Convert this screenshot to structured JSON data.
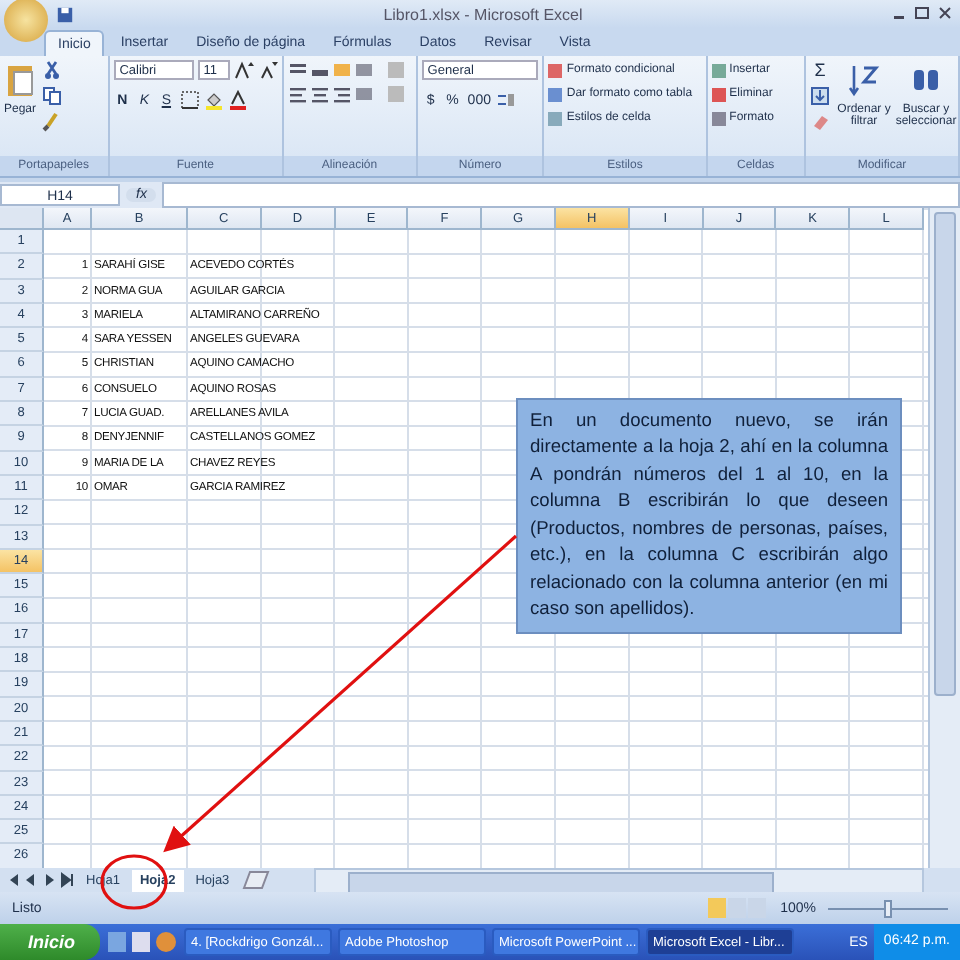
{
  "window": {
    "title": "Libro1.xlsx - Microsoft Excel"
  },
  "tabs": [
    {
      "label": "Inicio",
      "selected": true
    },
    {
      "label": "Insertar",
      "selected": false
    },
    {
      "label": "Diseño de página",
      "selected": false
    },
    {
      "label": "Fórmulas",
      "selected": false
    },
    {
      "label": "Datos",
      "selected": false
    },
    {
      "label": "Revisar",
      "selected": false
    },
    {
      "label": "Vista",
      "selected": false
    }
  ],
  "ribbon": {
    "clipboard": {
      "paste": "Pegar",
      "label": "Portapapeles"
    },
    "font": {
      "name": "Calibri",
      "size": "11",
      "bold": "N",
      "italic": "K",
      "underline": "S",
      "label": "Fuente"
    },
    "alignment": {
      "label": "Alineación"
    },
    "number": {
      "format": "General",
      "currency": "$",
      "percent": "%",
      "thousands": "000",
      "label": "Número"
    },
    "styles": {
      "buttons": [
        "Formato condicional",
        "Dar formato como tabla",
        "Estilos de celda"
      ],
      "label": "Estilos"
    },
    "cells": {
      "buttons": [
        "Insertar",
        "Eliminar",
        "Formato"
      ],
      "label": "Celdas"
    },
    "editing": {
      "sum": "Σ",
      "sort": "Ordenar y filtrar",
      "find": "Buscar y seleccionar",
      "label": "Modificar"
    }
  },
  "formula_bar": {
    "name_box": "H14",
    "fx": "fx"
  },
  "columns": [
    {
      "label": "A",
      "selected": false
    },
    {
      "label": "B",
      "selected": false
    },
    {
      "label": "C",
      "selected": false
    },
    {
      "label": "D",
      "selected": false
    },
    {
      "label": "E",
      "selected": false
    },
    {
      "label": "F",
      "selected": false
    },
    {
      "label": "G",
      "selected": false
    },
    {
      "label": "H",
      "selected": true
    },
    {
      "label": "I",
      "selected": false
    },
    {
      "label": "J",
      "selected": false
    },
    {
      "label": "K",
      "selected": false
    },
    {
      "label": "L",
      "selected": false
    }
  ],
  "rows": [
    {
      "label": "1",
      "selected": false
    },
    {
      "label": "2",
      "selected": false,
      "a": "1",
      "b": "SARAHÍ GISE",
      "c": "ACEVEDO CORTÉS"
    },
    {
      "label": "3",
      "selected": false,
      "a": "2",
      "b": "NORMA GUA",
      "c": "AGUILAR GARCIA"
    },
    {
      "label": "4",
      "selected": false,
      "a": "3",
      "b": "MARIELA",
      "c": "ALTAMIRANO CARREÑO"
    },
    {
      "label": "5",
      "selected": false,
      "a": "4",
      "b": "SARA YESSEN",
      "c": "ANGELES GUEVARA"
    },
    {
      "label": "6",
      "selected": false,
      "a": "5",
      "b": "CHRISTIAN",
      "c": "AQUINO CAMACHO"
    },
    {
      "label": "7",
      "selected": false,
      "a": "6",
      "b": "CONSUELO",
      "c": "AQUINO ROSAS"
    },
    {
      "label": "8",
      "selected": false,
      "a": "7",
      "b": "LUCIA GUAD.",
      "c": "ARELLANES AVILA"
    },
    {
      "label": "9",
      "selected": false,
      "a": "8",
      "b": "DENYJENNIF",
      "c": "CASTELLANOS GOMEZ"
    },
    {
      "label": "10",
      "selected": false,
      "a": "9",
      "b": "MARIA DE LA",
      "c": "CHAVEZ REYES"
    },
    {
      "label": "11",
      "selected": false,
      "a": "10",
      "b": "OMAR",
      "c": "GARCIA RAMIREZ"
    },
    {
      "label": "12",
      "selected": false
    },
    {
      "label": "13",
      "selected": false
    },
    {
      "label": "14",
      "selected": true
    },
    {
      "label": "15",
      "selected": false
    },
    {
      "label": "16",
      "selected": false
    },
    {
      "label": "17",
      "selected": false
    },
    {
      "label": "18",
      "selected": false
    },
    {
      "label": "19",
      "selected": false
    },
    {
      "label": "20",
      "selected": false
    },
    {
      "label": "21",
      "selected": false
    },
    {
      "label": "22",
      "selected": false
    },
    {
      "label": "23",
      "selected": false
    },
    {
      "label": "24",
      "selected": false
    },
    {
      "label": "25",
      "selected": false
    },
    {
      "label": "26",
      "selected": false
    }
  ],
  "sheet_tabs": [
    {
      "label": "Hoja1",
      "selected": false
    },
    {
      "label": "Hoja2",
      "selected": true
    },
    {
      "label": "Hoja3",
      "selected": false
    }
  ],
  "note": {
    "text": "En un documento nuevo, se irán directamente a la hoja 2, ahí en la columna A pondrán números del 1 al 10, en la columna B escribirán lo que deseen (Productos, nombres de personas, países, etc.), en la columna C escribirán algo relacionado con la columna anterior (en mi caso son apellidos)."
  },
  "status_bar": {
    "status": "Listo",
    "zoom": "100%",
    "level": 0.5
  },
  "taskbar": {
    "start": "Inicio",
    "items": [
      {
        "label": "4. [Rockdrigo Gonzál...",
        "selected": false
      },
      {
        "label": "Adobe Photoshop",
        "selected": false
      },
      {
        "label": "Microsoft PowerPoint ...",
        "selected": false
      },
      {
        "label": "Microsoft Excel - Libr...",
        "selected": true
      }
    ],
    "language": "ES",
    "clock": "06:42 p.m."
  }
}
